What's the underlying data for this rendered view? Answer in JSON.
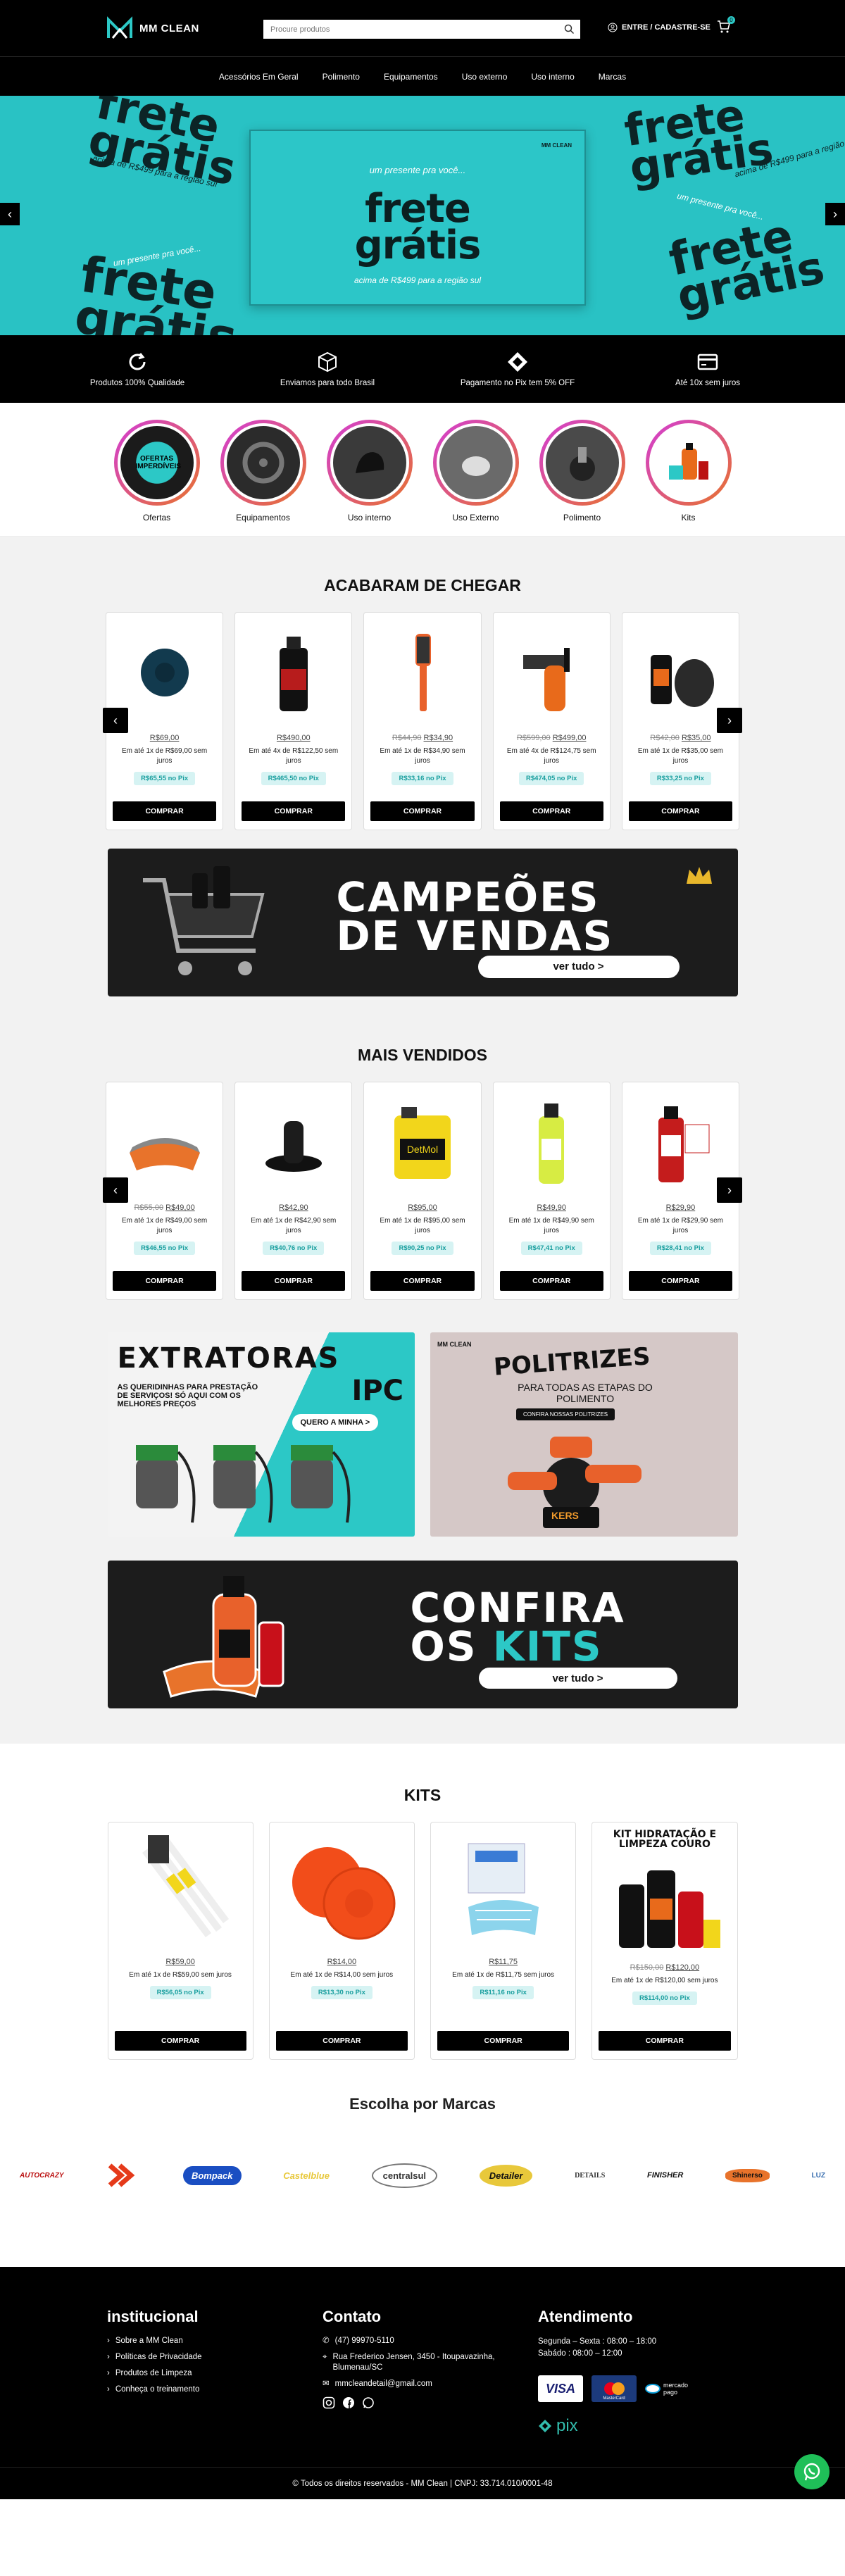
{
  "header": {
    "logo": "MM CLEAN",
    "search_placeholder": "Procure produtos",
    "login": "ENTRE / CADASTRE-SE",
    "cart_count": "0"
  },
  "nav": [
    "Acessórios Em Geral",
    "Polimento",
    "Equipamentos",
    "Uso externo",
    "Uso interno",
    "Marcas"
  ],
  "hero": {
    "pre": "um presente pra você...",
    "title_line1": "frete",
    "title_line2": "grátis",
    "sub": "acima de R$499 para a região sul",
    "card_logo": "MM CLEAN",
    "prev": "‹",
    "next": "›"
  },
  "benefits": [
    {
      "icon": "refresh-icon",
      "label": "Produtos 100% Qualidade"
    },
    {
      "icon": "box-icon",
      "label": "Enviamos para todo Brasil"
    },
    {
      "icon": "pix-icon",
      "label": "Pagamento no Pix tem 5% OFF"
    },
    {
      "icon": "card-icon",
      "label": "Até 10x sem juros"
    }
  ],
  "categories": [
    {
      "label": "Ofertas",
      "badge": "OFERTAS IMPERDÍVEIS"
    },
    {
      "label": "Equipamentos"
    },
    {
      "label": "Uso interno"
    },
    {
      "label": "Uso Externo"
    },
    {
      "label": "Polimento"
    },
    {
      "label": "Kits",
      "badge": "Kits"
    }
  ],
  "new_arrivals": {
    "title": "ACABARAM DE CHEGAR",
    "products": [
      {
        "old": "",
        "price": "R$69,00",
        "inst": "Em até 1x de R$69,00 sem juros",
        "pix": "R$65,55 no Pix"
      },
      {
        "old": "",
        "price": "R$490,00",
        "inst": "Em até 4x de R$122,50 sem juros",
        "pix": "R$465,50 no Pix"
      },
      {
        "old": "R$44,90",
        "price": "R$34,90",
        "inst": "Em até 1x de R$34,90 sem juros",
        "pix": "R$33,16 no Pix"
      },
      {
        "old": "R$599,00",
        "price": "R$499,00",
        "inst": "Em até 4x de R$124,75 sem juros",
        "pix": "R$474,05 no Pix"
      },
      {
        "old": "R$42,00",
        "price": "R$35,00",
        "inst": "Em até 1x de R$35,00 sem juros",
        "pix": "R$33,25 no Pix"
      }
    ]
  },
  "buy_label": "COMPRAR",
  "banner1": {
    "line1": "CAMPEÕES",
    "line2": "DE VENDAS",
    "btn": "ver tudo >"
  },
  "best_sellers": {
    "title": "MAIS VENDIDOS",
    "products": [
      {
        "old": "R$55,00",
        "price": "R$49,00",
        "inst": "Em até 1x de R$49,00 sem juros",
        "pix": "R$46,55 no Pix"
      },
      {
        "old": "",
        "price": "R$42,90",
        "inst": "Em até 1x de R$42,90 sem juros",
        "pix": "R$40,76 no Pix"
      },
      {
        "old": "",
        "price": "R$95,00",
        "inst": "Em até 1x de R$95,00 sem juros",
        "pix": "R$90,25 no Pix"
      },
      {
        "old": "",
        "price": "R$49,90",
        "inst": "Em até 1x de R$49,90 sem juros",
        "pix": "R$47,41 no Pix"
      },
      {
        "old": "",
        "price": "R$29,90",
        "inst": "Em até 1x de R$29,90 sem juros",
        "pix": "R$28,41 no Pix"
      }
    ]
  },
  "promo_left": {
    "title1": "EXTRATORAS",
    "title2": "IPC",
    "sub": "AS QUERIDINHAS PARA PRESTAÇÃO DE SERVIÇOS! SÓ AQUI COM OS MELHORES PREÇOS",
    "btn": "QUERO A MINHA >"
  },
  "promo_right": {
    "title": "POLITRIZES",
    "sub": "PARA TODAS AS ETAPAS DO POLIMENTO",
    "btn": "CONFIRA NOSSAS POLITRIZES",
    "tag": "KERS",
    "logo": "MM CLEAN"
  },
  "banner2": {
    "line1": "CONFIRA",
    "line2a": "OS ",
    "line2b": "KITS",
    "btn": "ver tudo >"
  },
  "kits": {
    "title": "KITS",
    "products": [
      {
        "old": "",
        "price": "R$59,00",
        "inst": "Em até 1x de R$59,00 sem juros",
        "pix": "R$56,05 no Pix"
      },
      {
        "old": "",
        "price": "R$14,00",
        "inst": "Em até 1x de R$14,00 sem juros",
        "pix": "R$13,30 no Pix"
      },
      {
        "old": "",
        "price": "R$11,75",
        "inst": "Em até 1x de R$11,75 sem juros",
        "pix": "R$11,16 no Pix"
      },
      {
        "old": "R$150,00",
        "price": "R$120,00",
        "inst": "Em até 1x de R$120,00 sem juros",
        "pix": "R$114,00 no Pix",
        "label": "KIT HIDRATAÇÃO E LIMPEZA COURO"
      }
    ]
  },
  "brands": {
    "title": "Escolha por Marcas",
    "items": [
      "AUTOCRAZY",
      "",
      "Bompack",
      "Castelblue",
      "centralsul",
      "Detailer",
      "DETAILS",
      "FINISHER",
      "Shinerso",
      "LUZ"
    ]
  },
  "footer": {
    "inst_title": "institucional",
    "inst_links": [
      "Sobre a MM Clean",
      "Políticas de Privacidade",
      "Produtos de Limpeza",
      "Conheça o treinamento"
    ],
    "contact_title": "Contato",
    "phone": "(47) 99970-5110",
    "address": "Rua Frederico Jensen, 3450 - Itoupavazinha, Blumenau/SC",
    "email": "mmcleandetail@gmail.com",
    "service_title": "Atendimento",
    "hours1": "Segunda – Sexta : 08:00 – 18:00",
    "hours2": "Sabádo : 08:00 – 12:00",
    "pay": [
      "VISA",
      "MasterCard",
      "mercado pago"
    ],
    "pix": "pix",
    "copyright": "© Todos os direitos reservados - MM Clean | CNPJ: 33.714.010/0001-48"
  },
  "colors": {
    "accent": "#2cc8c6",
    "black": "#000000",
    "whatsapp": "#1fbf58"
  }
}
